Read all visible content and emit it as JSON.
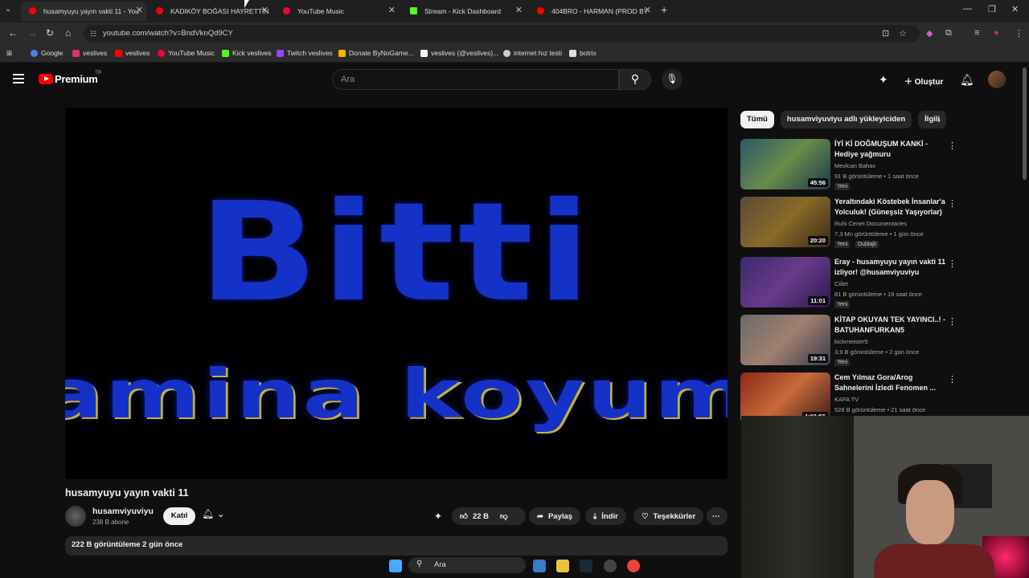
{
  "browser": {
    "tabs": [
      {
        "title": "husamyuyu yayın vakti 11 - You",
        "color": "#ff0000"
      },
      {
        "title": "KADIKÖY BOĞASI HAYRETTİN",
        "color": "#ff0000"
      },
      {
        "title": "YouTube Music",
        "color": "#ff0033"
      },
      {
        "title": "Stream - Kick Dashboard",
        "color": "#53fc18"
      },
      {
        "title": "404BRO - HARMAN (PROD BY",
        "color": "#ff0000"
      }
    ],
    "url": "youtube.com/watch?v=BndVknQd9CY",
    "bookmarks": [
      {
        "label": "Google",
        "color": "#4285f4"
      },
      {
        "label": "veslives",
        "color": "#e1306c"
      },
      {
        "label": "veslives",
        "color": "#ff0000"
      },
      {
        "label": "YouTube Music",
        "color": "#ff0033"
      },
      {
        "label": "Kick veslives",
        "color": "#53fc18"
      },
      {
        "label": "Twitch veslives",
        "color": "#9146ff"
      },
      {
        "label": "Donate ByNoGame...",
        "color": "#f5b400"
      },
      {
        "label": "veslives (@veslives)...",
        "color": "#ffffff"
      },
      {
        "label": "internet hız testi",
        "color": "#cccccc"
      },
      {
        "label": "botrix",
        "color": "#dddddd"
      }
    ]
  },
  "youtube": {
    "brand": "Premium",
    "region": "TR",
    "search_placeholder": "Ara",
    "create_label": "Oluştur"
  },
  "video": {
    "overlay_line1": "Bitti",
    "overlay_line2": "amina koyum",
    "title": "husamyuyu yayın vakti 11",
    "channel": "husamviyuviyu",
    "subscribers": "238 B abone",
    "join_label": "Katıl",
    "likes": "22 B",
    "share_label": "Paylaş",
    "download_label": "İndir",
    "thanks_label": "Teşekkürler",
    "views_date": "222 B görüntüleme  2 gün önce"
  },
  "chips": [
    "Tümü",
    "husamviyuviyu adlı yükleyiciden",
    "İlgili"
  ],
  "recommendations": [
    {
      "title": "İYİ Kİ DOĞMUŞUM KANKİ - Hediye yağmuru",
      "channel": "Mevlcan Bahav",
      "meta": "91 B görüntüleme • 1 saat önce",
      "badge": "Yeni",
      "duration": "45:56",
      "thumb": "#3a6a7a"
    },
    {
      "title": "Yeraltındaki Köstebek İnsanlar'a Yolculuk! (Güneşsiz Yaşıyorlar)",
      "channel": "Ruhi Cenet Documentaries",
      "meta": "7,3 Mn görüntüleme • 1 gün önce",
      "badge": "Yeni",
      "badge2": "Dublajlı",
      "duration": "20:20",
      "thumb": "#6a5a3a"
    },
    {
      "title": "Eray - husamyuyu yayın vakti 11 izliyor! @husamviyuviyu",
      "channel": "Ciilet",
      "meta": "81 B görüntüleme • 19 saat önce",
      "badge": "Yeni",
      "duration": "11:01",
      "thumb": "#4a3a6a"
    },
    {
      "title": "KİTAP OKUYAN TEK YAYINCI..! - BATUHANFURKAN5",
      "channel": "kickmeister5",
      "meta": "3,9 B görüntüleme • 2 gün önce",
      "badge": "Yeni",
      "duration": "19:31",
      "thumb": "#7a6a5a"
    },
    {
      "title": "Cem Yılmaz Gora/Arog Sahnelerini İzledi Fenomen ...",
      "channel": "KAFA TV",
      "meta": "528 B görüntüleme • 21 saat önce",
      "badge": "",
      "duration": "1:01:56",
      "thumb": "#8a3a2a"
    }
  ],
  "taskbar": {
    "search_label": "Ara"
  }
}
